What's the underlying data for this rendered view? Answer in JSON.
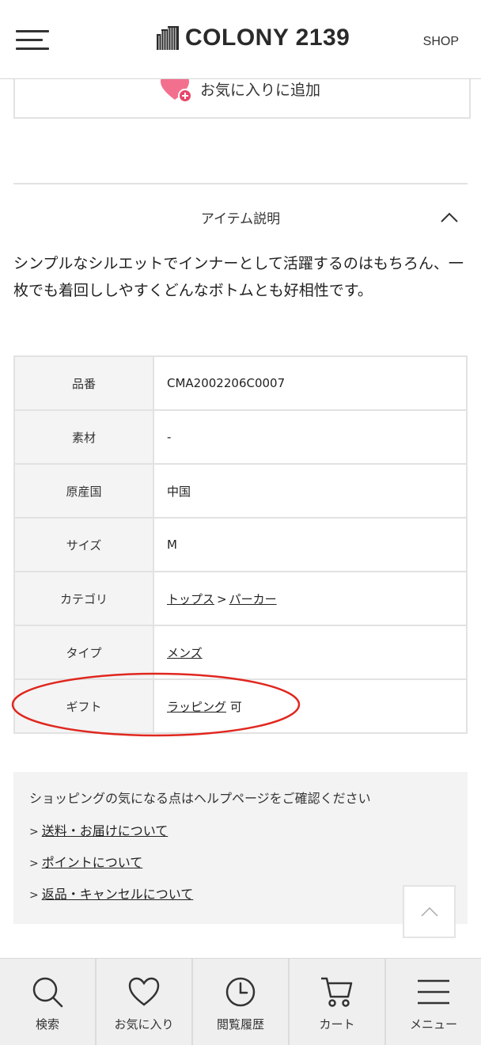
{
  "header": {
    "logo_text": "COLONY 2139",
    "shop_label": "SHOP"
  },
  "favorite": {
    "label": "お気に入りに追加",
    "heart_color": "#f2708e"
  },
  "description": {
    "title": "アイテム説明",
    "body": "シンプルなシルエットでインナーとして活躍するのはもちろん、一枚でも着回ししやすくどんなボトムとも好相性です。"
  },
  "specs": {
    "rows": [
      {
        "label": "品番",
        "value": "CMA2002206C0007"
      },
      {
        "label": "素材",
        "value": "-"
      },
      {
        "label": "原産国",
        "value": "中国"
      },
      {
        "label": "サイズ",
        "value": "M"
      },
      {
        "label": "カテゴリ",
        "link1": "トップス",
        "separator": ">",
        "link2": "パーカー"
      },
      {
        "label": "タイプ",
        "link1": "メンズ"
      },
      {
        "label": "ギフト",
        "link1": "ラッピング",
        "suffix": "可"
      }
    ]
  },
  "annotation": {
    "color": "#e0271f"
  },
  "help": {
    "title": "ショッピングの気になる点はヘルプページをご確認ください",
    "links": [
      {
        "prefix": ">",
        "label": "送料・お届けについて"
      },
      {
        "prefix": ">",
        "label": "ポイントについて"
      },
      {
        "prefix": ">",
        "label": "返品・キャンセルについて"
      }
    ]
  },
  "bottom_nav": [
    {
      "icon": "search-icon",
      "label": "検索"
    },
    {
      "icon": "heart-icon",
      "label": "お気に入り"
    },
    {
      "icon": "clock-icon",
      "label": "閲覧履歴"
    },
    {
      "icon": "cart-icon",
      "label": "カート"
    },
    {
      "icon": "menu-icon",
      "label": "メニュー"
    }
  ]
}
